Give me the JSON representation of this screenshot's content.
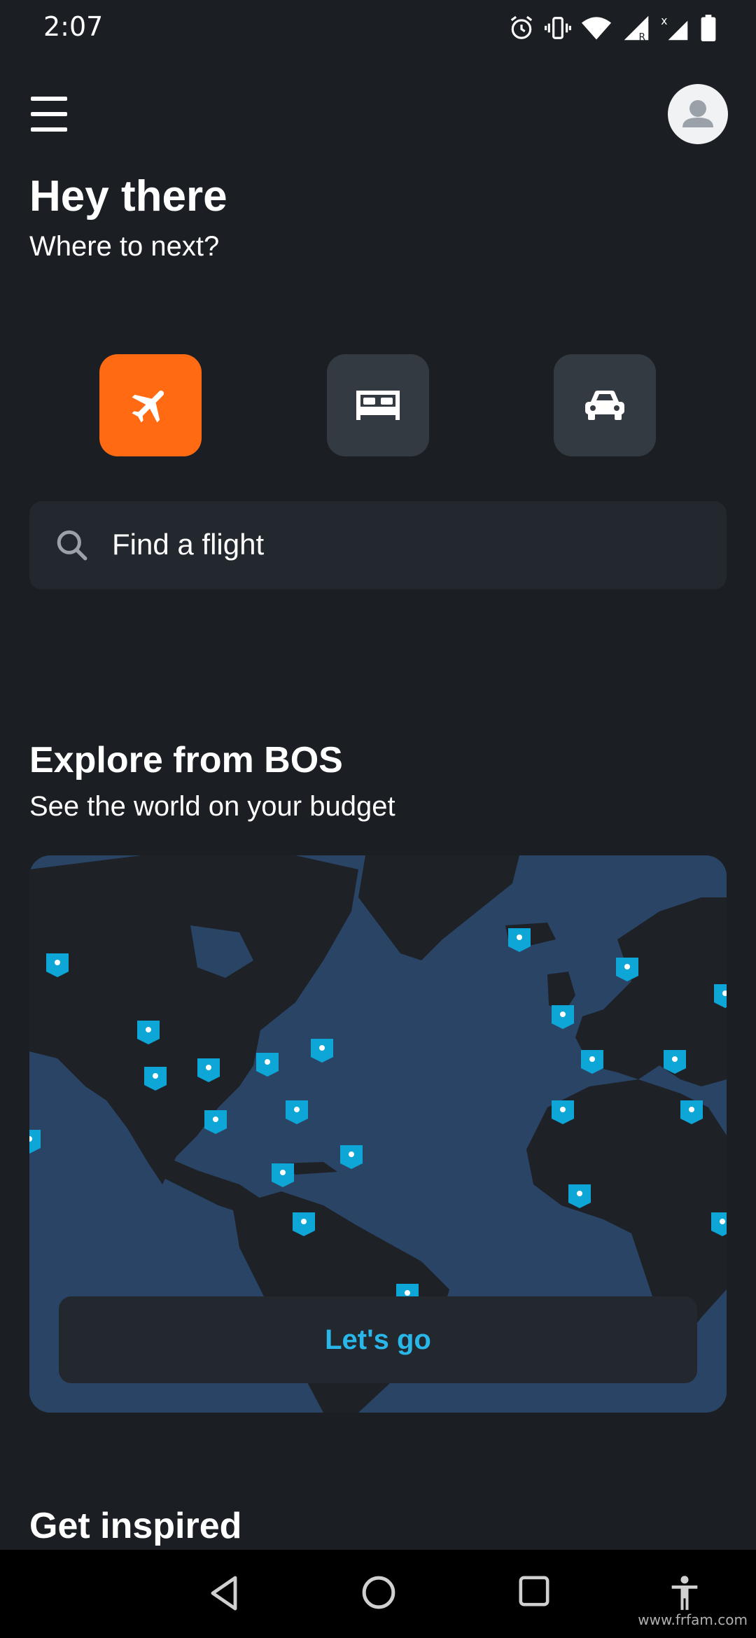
{
  "status_bar": {
    "time": "2:07"
  },
  "header": {
    "greeting_title": "Hey there",
    "greeting_subtitle": "Where to next?"
  },
  "modes": [
    {
      "name": "flights",
      "icon": "airplane-icon",
      "active": true
    },
    {
      "name": "hotels",
      "icon": "bed-icon",
      "active": false
    },
    {
      "name": "cars",
      "icon": "car-icon",
      "active": false
    }
  ],
  "search": {
    "placeholder": "Find a flight"
  },
  "explore": {
    "title": "Explore from BOS",
    "subtitle": "See the world on your budget",
    "button_label": "Let's go"
  },
  "inspired": {
    "title": "Get inspired"
  },
  "watermark": "www.frfam.com",
  "colors": {
    "background": "#1b1f23",
    "accent_orange": "#ff6a13",
    "accent_blue": "#29b6e8",
    "map_ocean": "#2a4466",
    "map_land": "#1e2126",
    "pin": "#0ea5d7"
  }
}
